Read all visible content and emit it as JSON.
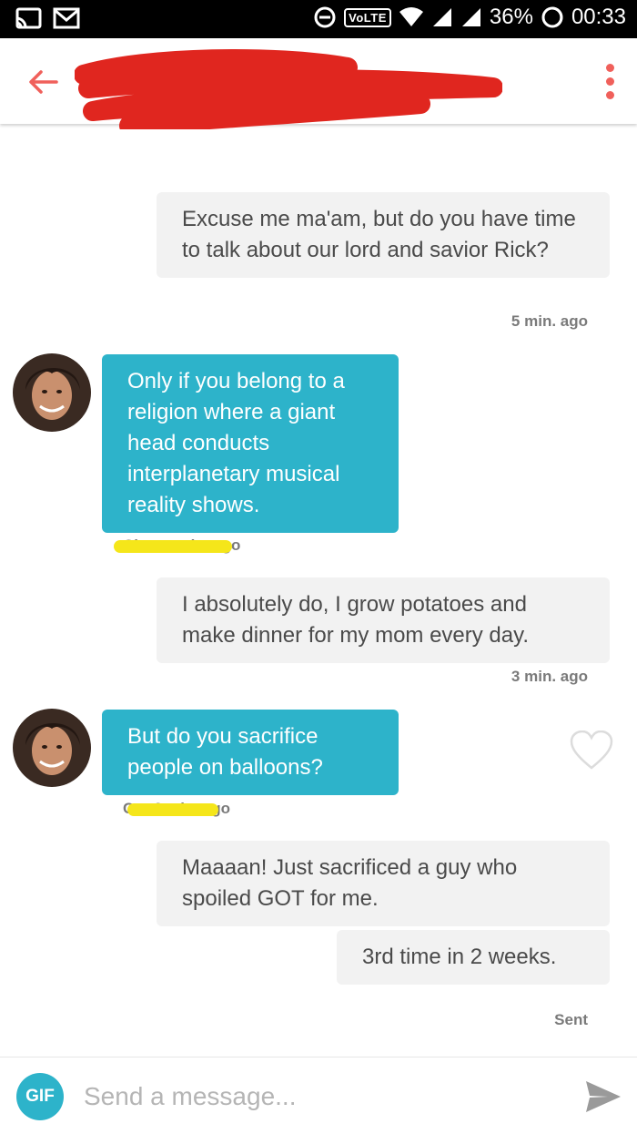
{
  "status_bar": {
    "battery": "36%",
    "time": "00:33",
    "network": "VoLTE"
  },
  "header": {
    "name_redacted": true
  },
  "messages": [
    {
      "direction": "out",
      "text": "Excuse me ma'am, but do you have time to talk about our lord and savior Rick?",
      "meta": "5 min. ago"
    },
    {
      "direction": "in",
      "text": "Only if you belong to a religion where a giant head conducts interplanetary musical reality shows.",
      "meta": "Chat… min. ago"
    },
    {
      "direction": "out",
      "text": "I absolutely do, I grow potatoes and make dinner for my mom every day.",
      "meta": "3 min. ago"
    },
    {
      "direction": "in",
      "text": "But do you sacrifice people on balloons?",
      "meta": "C… 2 min. ago"
    },
    {
      "direction": "out",
      "text": "Maaaan! Just sacrificed a guy who spoiled GOT for me.",
      "meta": ""
    },
    {
      "direction": "out",
      "text": "3rd time in 2 weeks.",
      "meta": "Sent"
    }
  ],
  "composer": {
    "gif_label": "GIF",
    "placeholder": "Send a message..."
  },
  "colors": {
    "accent": "#f0605b",
    "incoming_bubble": "#2db3ca",
    "outgoing_bubble": "#f2f2f2",
    "redaction": "#e0261f",
    "highlight": "#f5e61a"
  },
  "icons": [
    "cast-icon",
    "gmail-icon",
    "data-saver-icon",
    "wifi-icon",
    "signal-icon",
    "battery-icon",
    "back-arrow-icon",
    "more-vert-icon",
    "heart-icon",
    "send-icon"
  ]
}
